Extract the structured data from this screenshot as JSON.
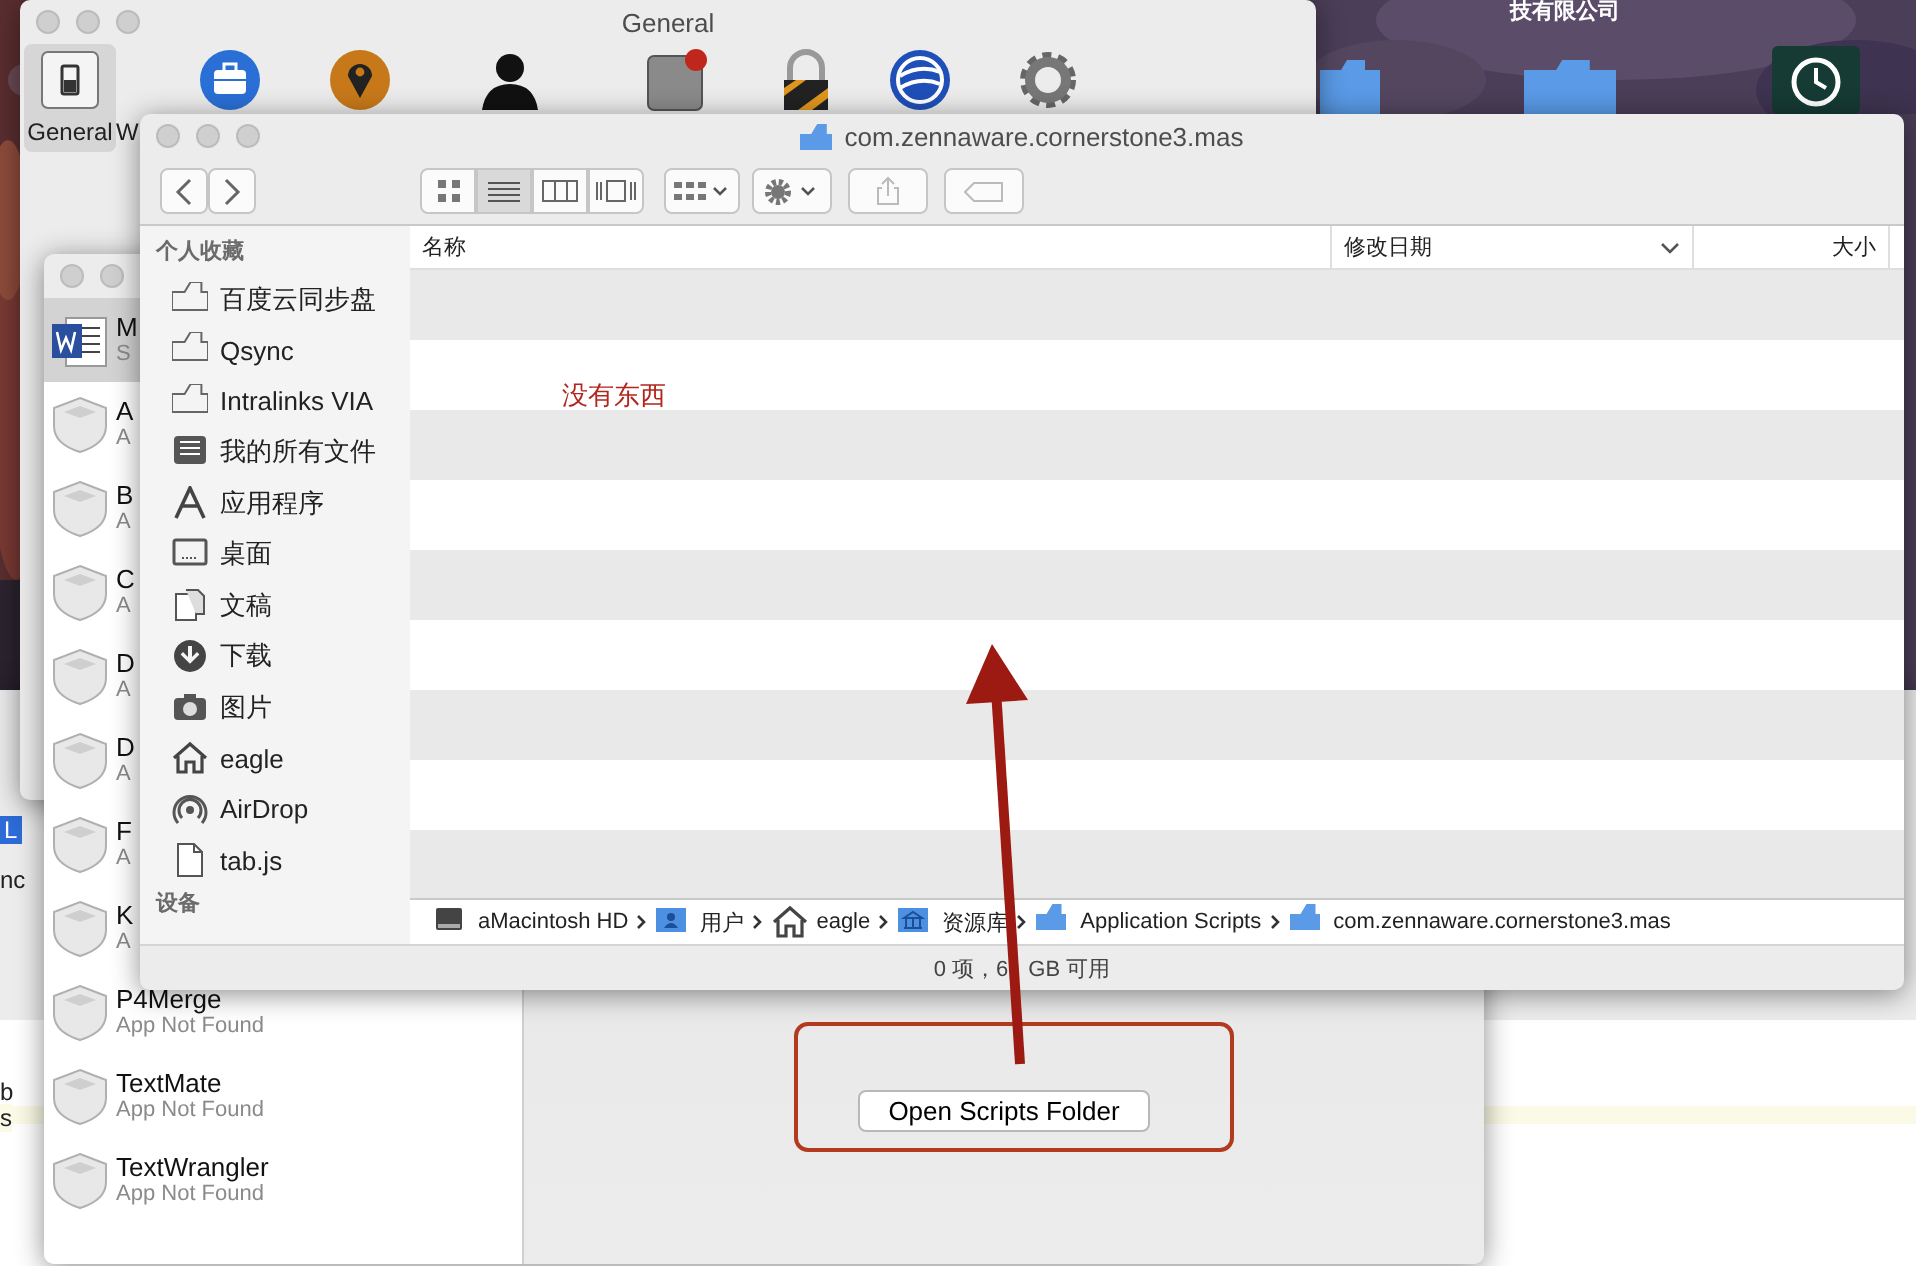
{
  "desktop": {
    "label": "技有限公司"
  },
  "background_window": {
    "fragments": [
      {
        "text": "L",
        "kind": "selected"
      },
      {
        "text": "nc",
        "kind": "plain"
      },
      {
        "text": "b",
        "kind": "plain"
      },
      {
        "text": "s",
        "kind": "highlight"
      }
    ]
  },
  "preferences_window": {
    "title": "General",
    "toolbar": [
      {
        "kind": "switch",
        "label": "General",
        "selected": true
      },
      {
        "kind": "briefcase",
        "label": "W",
        "selected": false
      },
      {
        "kind": "pin",
        "selected": false
      },
      {
        "kind": "person",
        "selected": false
      },
      {
        "kind": "badge-square",
        "selected": false
      },
      {
        "kind": "lock",
        "selected": false
      },
      {
        "kind": "globe",
        "selected": false
      },
      {
        "kind": "gear",
        "selected": false
      }
    ]
  },
  "apps_window": {
    "apps": [
      {
        "kind": "word",
        "name": "M",
        "status": "S",
        "selected": true
      },
      {
        "kind": "generic",
        "name": "A",
        "status": "A",
        "selected": false
      },
      {
        "kind": "generic",
        "name": "B",
        "status": "A",
        "selected": false
      },
      {
        "kind": "generic",
        "name": "C",
        "status": "A",
        "selected": false
      },
      {
        "kind": "generic",
        "name": "D",
        "status": "A",
        "selected": false
      },
      {
        "kind": "generic",
        "name": "D",
        "status": "A",
        "selected": false
      },
      {
        "kind": "generic",
        "name": "F",
        "status": "A",
        "selected": false
      },
      {
        "kind": "generic",
        "name": "K",
        "status": "A",
        "selected": false
      },
      {
        "kind": "generic",
        "name": "P4Merge",
        "status": "App Not Found",
        "selected": false
      },
      {
        "kind": "generic",
        "name": "TextMate",
        "status": "App Not Found",
        "selected": false
      },
      {
        "kind": "generic",
        "name": "TextWrangler",
        "status": "App Not Found",
        "selected": false
      }
    ],
    "button": "Open Scripts Folder"
  },
  "finder_window": {
    "title": "com.zennaware.cornerstone3.mas",
    "view_modes": [
      {
        "kind": "icons",
        "selected": false
      },
      {
        "kind": "list",
        "selected": true
      },
      {
        "kind": "columns",
        "selected": false
      },
      {
        "kind": "cover",
        "selected": false
      }
    ],
    "sidebar": [
      {
        "heading": "个人收藏",
        "items": [
          {
            "kind": "folder",
            "label": "百度云同步盘"
          },
          {
            "kind": "folder",
            "label": "Qsync"
          },
          {
            "kind": "folder",
            "label": "Intralinks VIA"
          },
          {
            "kind": "all-files",
            "label": "我的所有文件"
          },
          {
            "kind": "apps",
            "label": "应用程序"
          },
          {
            "kind": "desktop",
            "label": "桌面"
          },
          {
            "kind": "documents",
            "label": "文稿"
          },
          {
            "kind": "download",
            "label": "下载"
          },
          {
            "kind": "pictures",
            "label": "图片"
          },
          {
            "kind": "home",
            "label": "eagle"
          },
          {
            "kind": "airdrop",
            "label": "AirDrop"
          },
          {
            "kind": "file",
            "label": "tab.js"
          }
        ]
      },
      {
        "heading": "设备"
      }
    ],
    "columns": [
      {
        "label": "名称",
        "sorted": false
      },
      {
        "label": "修改日期",
        "sorted": true
      },
      {
        "label": "大小",
        "sorted": false
      }
    ],
    "note": "没有东西",
    "path": [
      {
        "kind": "disk",
        "label": "aMacintosh HD"
      },
      {
        "kind": "users",
        "label": "用户"
      },
      {
        "kind": "home",
        "label": "eagle"
      },
      {
        "kind": "library",
        "label": "资源库"
      },
      {
        "kind": "folder",
        "label": "Application Scripts"
      },
      {
        "kind": "folder",
        "label": "com.zennaware.cornerstone3.mas"
      }
    ],
    "status_parts": [
      "0 项，6",
      "GB 可用"
    ]
  }
}
